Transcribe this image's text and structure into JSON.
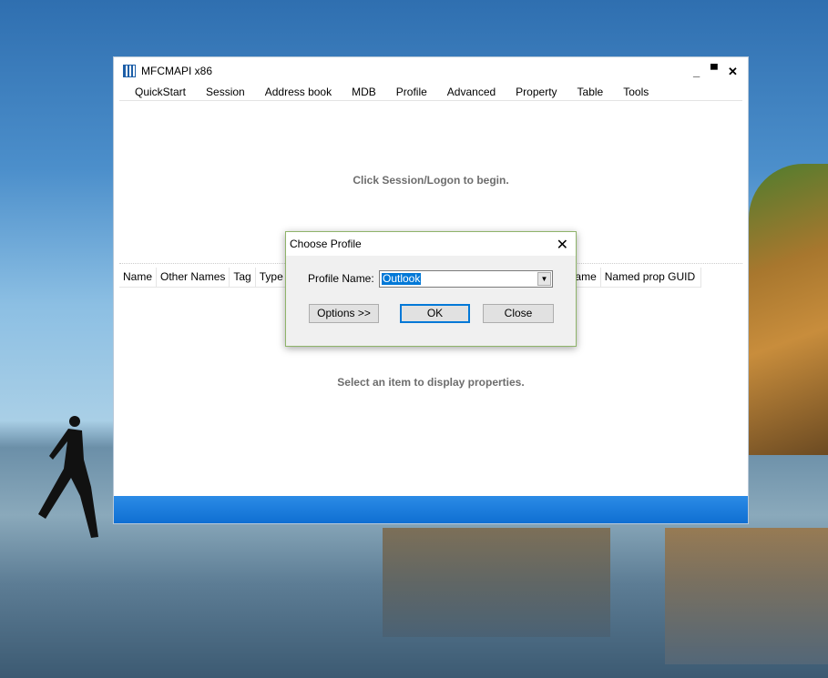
{
  "window": {
    "title": "MFCMAPI x86",
    "controls": {
      "minimize": "_",
      "maximize": "▀",
      "close": "✕"
    }
  },
  "menu": [
    "QuickStart",
    "Session",
    "Address book",
    "MDB",
    "Profile",
    "Advanced",
    "Property",
    "Table",
    "Tools"
  ],
  "top_message": "Click Session/Logon to begin.",
  "columns": [
    "Name",
    "Other Names",
    "Tag",
    "Type",
    "",
    "name",
    "Named prop GUID"
  ],
  "bottom_message": "Select an item to display properties.",
  "dialog": {
    "title": "Choose Profile",
    "close": "✕",
    "profile_label": "Profile Name:",
    "profile_value": "Outlook",
    "options": "Options >>",
    "ok": "OK",
    "close_btn": "Close"
  },
  "colors": {
    "status_bar": "#1a7ee0",
    "selection": "#0078d7",
    "dialog_border": "#8fb46a"
  }
}
